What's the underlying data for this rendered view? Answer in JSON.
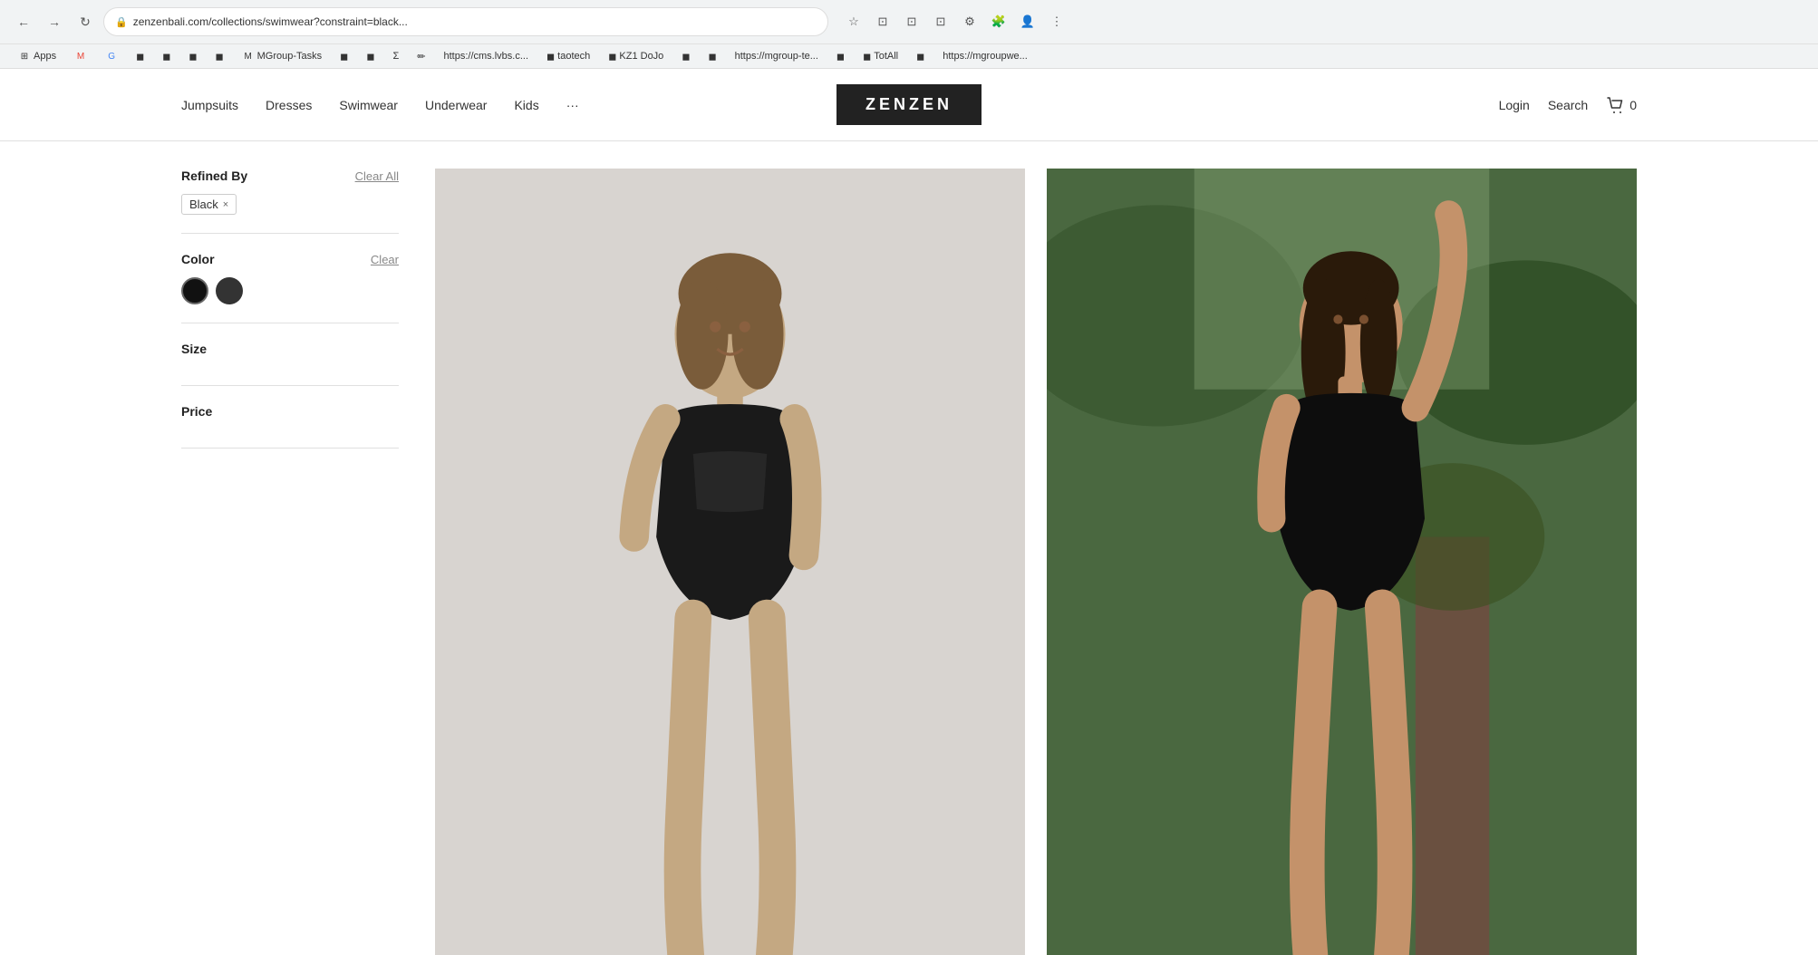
{
  "browser": {
    "url": "zenzenbali.com/collections/swimwear?constraint=black...",
    "back_btn": "←",
    "forward_btn": "→",
    "reload_btn": "↺",
    "bookmarks": [
      {
        "label": "Apps",
        "icon": "⊞"
      },
      {
        "label": "M",
        "icon": "M",
        "color": "#EA4335"
      },
      {
        "label": "G",
        "icon": "G",
        "color": "#4285F4"
      },
      {
        "label": "",
        "icon": "◼"
      },
      {
        "label": "",
        "icon": "◼"
      },
      {
        "label": "",
        "icon": "◼"
      },
      {
        "label": "",
        "icon": "◼"
      },
      {
        "label": "MGroup-Tasks",
        "icon": "M"
      },
      {
        "label": "",
        "icon": "◼"
      },
      {
        "label": "",
        "icon": "◼"
      },
      {
        "label": "",
        "icon": "Σ"
      },
      {
        "label": "",
        "icon": "✏"
      },
      {
        "label": "https://cms.lvbs.c...",
        "icon": "🌐"
      },
      {
        "label": "taotech",
        "icon": "◼"
      },
      {
        "label": "KZ1 DoJo",
        "icon": "◼"
      },
      {
        "label": "",
        "icon": "◼"
      },
      {
        "label": "",
        "icon": "◼"
      },
      {
        "label": "https://mgroup-te...",
        "icon": "🌐"
      },
      {
        "label": "",
        "icon": "◼"
      },
      {
        "label": "TotAll",
        "icon": "◼"
      },
      {
        "label": "",
        "icon": "◼"
      },
      {
        "label": "https://mgroupwe...",
        "icon": "🌐"
      }
    ]
  },
  "header": {
    "nav_items": [
      "Jumpsuits",
      "Dresses",
      "Swimwear",
      "Underwear",
      "Kids",
      "···"
    ],
    "logo": "ZENZEN",
    "login_label": "Login",
    "search_label": "Search",
    "cart_count": "0"
  },
  "sidebar": {
    "refined_by_title": "Refined By",
    "clear_all_label": "Clear All",
    "active_filters": [
      {
        "label": "Black",
        "removable": true
      }
    ],
    "color_title": "Color",
    "color_clear_label": "Clear",
    "colors": [
      {
        "name": "black",
        "class": "black",
        "selected": true
      },
      {
        "name": "dark-gray",
        "class": "dark-gray",
        "selected": false
      }
    ],
    "size_title": "Size",
    "price_title": "Price"
  },
  "products": [
    {
      "id": 1,
      "alt": "Black swimsuit on light background - woman posing"
    },
    {
      "id": 2,
      "alt": "Black swimsuit outdoor green background - woman posing"
    }
  ]
}
